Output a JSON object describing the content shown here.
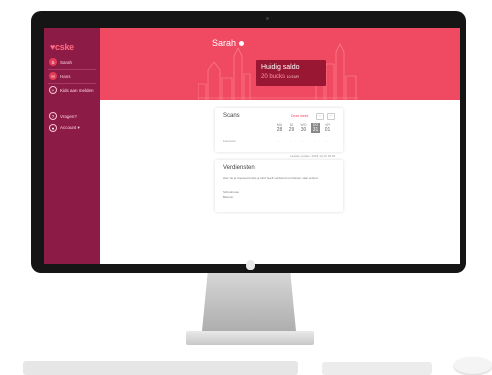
{
  "app": {
    "logo": "♥cske"
  },
  "sidebar": {
    "items": [
      {
        "label": "Sarah",
        "initial": "S"
      },
      {
        "label": "Hans",
        "initial": "H"
      },
      {
        "label": "Kids aan melden",
        "initial": "+"
      },
      {
        "label": "Vragen?",
        "initial": "?"
      },
      {
        "label": "Account ▾",
        "initial": "●"
      }
    ]
  },
  "header": {
    "title": "Sarah"
  },
  "saldo": {
    "label": "Huidig saldo",
    "value": "20 bucks",
    "eur": "10 EUR"
  },
  "scans": {
    "title": "Scans",
    "link": "Deze week",
    "days": [
      {
        "d": "MA",
        "n": "28"
      },
      {
        "d": "DI",
        "n": "29"
      },
      {
        "d": "WO",
        "n": "30"
      },
      {
        "d": "DO",
        "n": "31"
      },
      {
        "d": "VR",
        "n": "01"
      }
    ],
    "row_label": "Fietsscan",
    "values": [
      "-",
      "-",
      "-",
      "-",
      "-"
    ],
    "updated": "Laatste update: 2018-10-15 18:29"
  },
  "rewards": {
    "title": "Verdiensten",
    "text": "Hier zie je hoeveel bucks je kind heeft verdiend met fietsen naar school.",
    "extra1": "Schoolroute",
    "extra2": "Beloner"
  },
  "colors": {
    "accent": "#ef4a62",
    "sidebar": "#8c1b46"
  }
}
